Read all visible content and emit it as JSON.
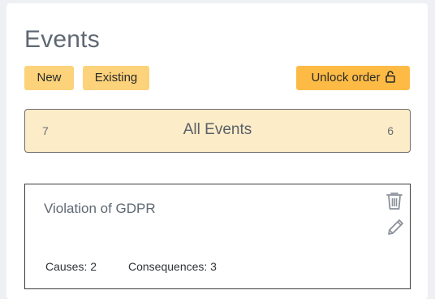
{
  "page": {
    "title": "Events"
  },
  "toolbar": {
    "new_label": "New",
    "existing_label": "Existing",
    "unlock_label": "Unlock order",
    "unlock_icon": "lock-open-icon"
  },
  "all_events": {
    "left_count": "7",
    "label": "All Events",
    "right_count": "6"
  },
  "events": [
    {
      "name": "Violation of GDPR",
      "causes_text": "Causes: 2",
      "consequences_text": "Consequences: 3",
      "delete_icon": "trash-icon",
      "edit_icon": "pencil-icon"
    }
  ],
  "colors": {
    "button_light": "#fcd27a",
    "button_accent": "#fdbb45",
    "all_events_bg": "#fdecc8",
    "title_text": "#5f6873"
  }
}
